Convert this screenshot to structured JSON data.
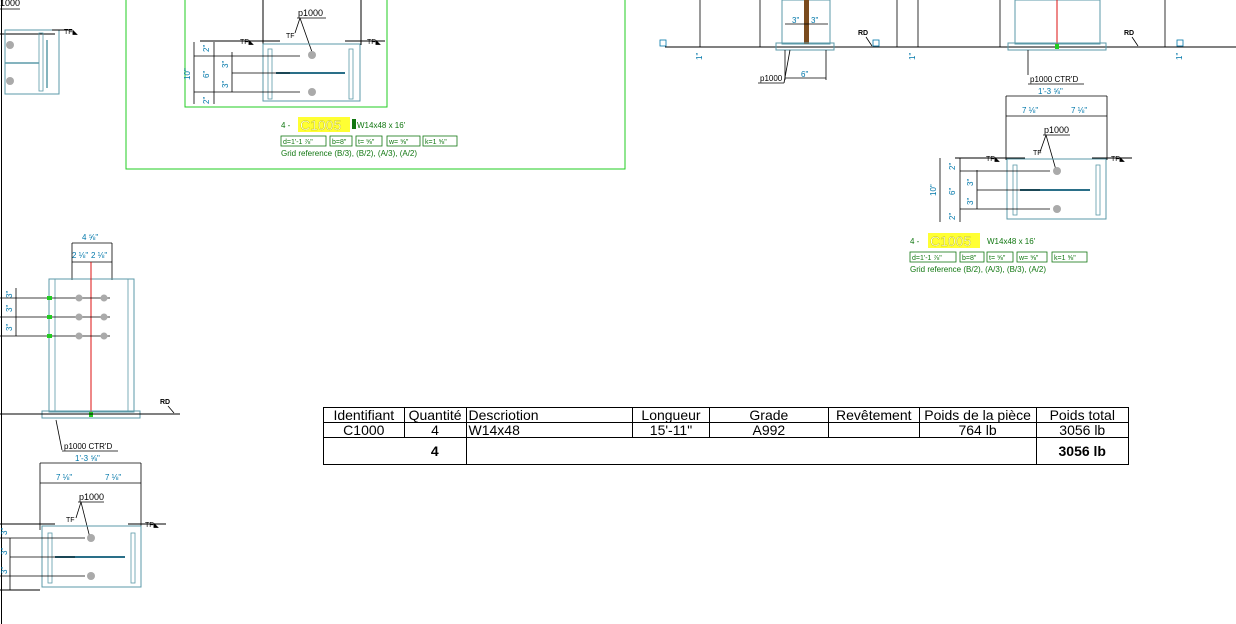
{
  "drawing": {
    "views": [
      {
        "id": "A",
        "piece_mark": "p1000",
        "mark_label_top": "1000",
        "dims_vertical": [
          "10\"",
          "2\"",
          "6\"",
          "2\"",
          "3\"",
          "3\"",
          "3\""
        ]
      },
      {
        "id": "B",
        "mark_top": "p1000",
        "qty_prefix": "4 -",
        "mark": "C1005",
        "profile": "W14x48 x 16'",
        "props": [
          "d=1'-1 ⅞\"",
          "b=8\"",
          "t= ⅝\"",
          "w= ⅝\"",
          "k=1 ⅝\""
        ],
        "grid_ref": "Grid reference (B/3), (B/2), (A/3), (A/2)",
        "dims_vertical": [
          "10\"",
          "6\"",
          "2\"",
          "3\"",
          "3\"",
          "2\""
        ]
      },
      {
        "id": "C",
        "dims_top": [
          "3\"",
          "3\""
        ],
        "dim_bottom": "6\"",
        "piece_mark": "p1000",
        "rd_label": "RD"
      },
      {
        "id": "D",
        "callout": "p1000 CTR'D",
        "dim_overall": "1'-3 ⅝\"",
        "dims_halves": [
          "7 ⅛\"",
          "7 ⅛\""
        ],
        "mark_top": "p1000",
        "qty_prefix": "4 -",
        "mark": "C1005",
        "profile": "W14x48 x 16'",
        "props": [
          "d=1'-1 ⅞\"",
          "b=8\"",
          "t= ⅝\"",
          "w= ⅝\"",
          "k=1 ⅝\""
        ],
        "grid_ref": "Grid reference (B/2), (A/3), (B/3), (A/2)",
        "dims_vertical": [
          "10\"",
          "2\"",
          "6\"",
          "3\"",
          "3\"",
          "2\""
        ],
        "rd_label": "RD"
      },
      {
        "id": "E",
        "dim_overall": "4 ⅝\"",
        "dims_halves": [
          "2 ⅛\"",
          "2 ⅛\""
        ],
        "dims_vertical": [
          "3\"",
          "3\"",
          "3\""
        ],
        "rd_label": "RD",
        "callout": "p1000 CTR'D",
        "dim_callout": "1'-3 ⅝\""
      },
      {
        "id": "F",
        "dims_halves": [
          "7 ⅛\"",
          "7 ⅛\""
        ],
        "mark_top": "p1000",
        "dims_vertical": [
          "3\"",
          "3\"",
          "3\""
        ]
      }
    ]
  },
  "bom": {
    "headers": [
      "Identifiant",
      "Quantité",
      "Descriotion",
      "Longueur",
      "Grade",
      "Revêtement",
      "Poids de la pièce",
      "Poids total"
    ],
    "rows": [
      [
        "C1000",
        "4",
        "W14x48",
        "15'-11\"",
        "A992",
        "",
        "764 lb",
        "3056 lb"
      ]
    ],
    "total_quantity": "4",
    "total_weight": "3056 lb"
  },
  "colors": {
    "frame_green": "#22cc22",
    "mark_yellow": "#ffff33",
    "steel_blue": "#5b9aa8",
    "dim_cyan": "#0077aa",
    "note_green": "#117711",
    "center_red": "#dd1111"
  }
}
